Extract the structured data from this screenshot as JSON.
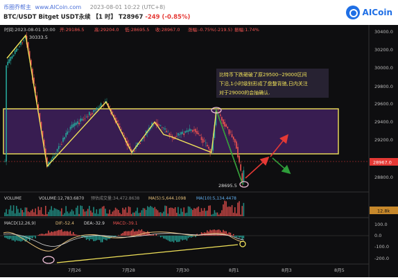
{
  "header": {
    "brand": "币圈乔帮主",
    "watermark_site": "www.AICoin.com",
    "timestamp": "2023-08-01 10:22 (UTC+8)",
    "symbol": "BTC/USDT Bitget USDT永续",
    "interval": "【1 时】",
    "price": "T28967",
    "change": "-249 (-0.85%)",
    "logo": "AICoin"
  },
  "ohlc_bar": {
    "time": "时间:2023-08-01 10:00",
    "open": "开:29186.5",
    "high": "高:29204.0",
    "low": "低:28695.5",
    "close": "收:28967.0",
    "change": "涨幅:-0.75%(-219.5)",
    "amplitude": "振幅:1.74%"
  },
  "price_axis": {
    "ticks": [
      "30400.0",
      "30200.0",
      "30000.0",
      "29800.0",
      "29600.0",
      "29400.0",
      "29200.0",
      "28800.0"
    ],
    "current": "28967.0"
  },
  "labels": {
    "high_mark": "30333.5",
    "low_mark": "28695.5",
    "annotation_line1": "比特币下跌砸破了原29500--29000区间",
    "annotation_line2": "下沿,1小时级别形成了盘整背驰,日内关注",
    "annotation_line3": "对于29000的会抽确认."
  },
  "volume": {
    "title": "VOLUME",
    "vol": "VOLUME:12,783.6870",
    "forecast": "预估成交量:34,472.8638",
    "ma5": "MA(5):5,644.1098",
    "ma10": "MA(10):5,134.4478",
    "badge": "12.8k"
  },
  "macd": {
    "title": "MACD(12,26,9)",
    "dif": "DIF:-52.4",
    "dea": "DEA:-32.9",
    "macd": "MACD:-39.1",
    "ticks": [
      "100.0",
      "0.0",
      "-100.0",
      "-200.0"
    ]
  },
  "time_axis": [
    "7月26",
    "7月28",
    "7月30",
    "8月1",
    "8月3",
    "8月5"
  ],
  "colors": {
    "up": "#26a69a",
    "down": "#ef5350",
    "zone": "#5b2a86",
    "zone_border": "#f2e35a",
    "zigzag": "#f2e35a",
    "arrow_red": "#e53935",
    "arrow_green": "#2e9d3a"
  }
}
